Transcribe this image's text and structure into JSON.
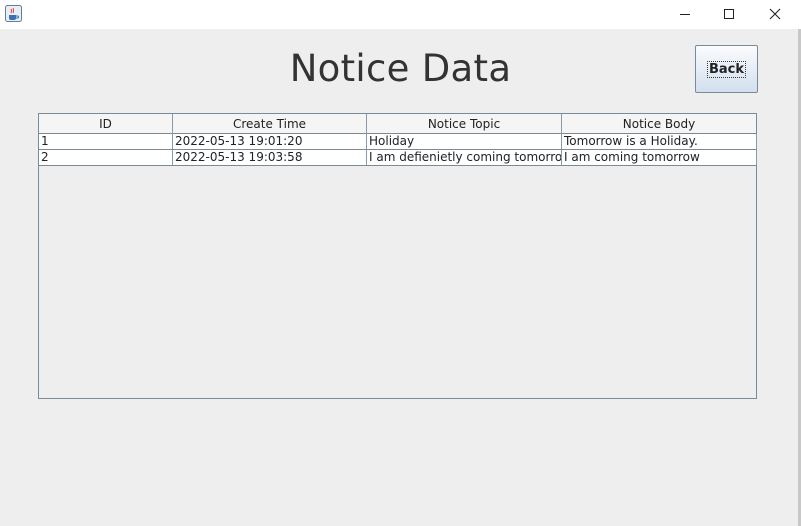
{
  "window": {
    "title": "",
    "controls": {
      "minimize": "minimize",
      "maximize": "maximize",
      "close": "close"
    }
  },
  "page": {
    "title": "Notice Data",
    "back_label": "Back"
  },
  "table": {
    "columns": [
      "ID",
      "Create Time",
      "Notice Topic",
      "Notice Body"
    ],
    "rows": [
      [
        "1",
        "2022-05-13 19:01:20",
        "Holiday",
        "Tomorrow is a Holiday."
      ],
      [
        "2",
        "2022-05-13 19:03:58",
        "I am defienietly coming tomorrow",
        "I am coming tomorrow"
      ]
    ]
  },
  "colors": {
    "background": "#eeeeee",
    "titlebar": "#ffffff",
    "grid_line": "#7a8a99",
    "button_top": "#fbfcfe",
    "button_bottom": "#d2dfee"
  }
}
